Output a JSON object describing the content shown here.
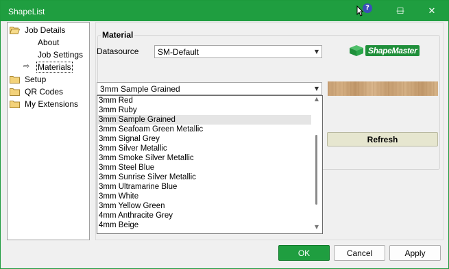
{
  "window": {
    "title": "ShapeList"
  },
  "titlebar": {
    "help_glyph": "?",
    "minimize_glyph": "—",
    "maximize_glyph": "☐",
    "close_glyph": "✕"
  },
  "tree": {
    "items": [
      {
        "label": "Job Details",
        "icon": "folder-open-icon"
      },
      {
        "label": "About"
      },
      {
        "label": "Job Settings"
      },
      {
        "label": "Materials",
        "selected": true,
        "icon": "arrow-right-icon"
      },
      {
        "label": "Setup",
        "icon": "folder-icon"
      },
      {
        "label": "QR Codes",
        "icon": "folder-icon"
      },
      {
        "label": "My Extensions",
        "icon": "folder-icon"
      }
    ]
  },
  "material": {
    "group_title": "Material",
    "datasource_label": "Datasource",
    "datasource_value": "SM-Default",
    "material_value": "3mm Sample Grained",
    "refresh_label": "Refresh",
    "logo_text": "ShapeMaster"
  },
  "dropdown": {
    "highlighted": "3mm Sample Grained",
    "options": [
      "3mm Red",
      "3mm Ruby",
      "3mm Sample Grained",
      "3mm Seafoam Green Metallic",
      "3mm Signal Grey",
      "3mm Silver Metallic",
      "3mm Smoke Silver Metallic",
      "3mm Steel Blue",
      "3mm Sunrise Silver Metallic",
      "3mm Ultramarine Blue",
      "3mm White",
      "3mm Yellow Green",
      "4mm Anthracite Grey",
      "4mm Beige"
    ]
  },
  "buttons": {
    "ok": "OK",
    "cancel": "Cancel",
    "apply": "Apply"
  },
  "colors": {
    "accent": "#1f9e40",
    "titlebar": "#1f9e40"
  }
}
